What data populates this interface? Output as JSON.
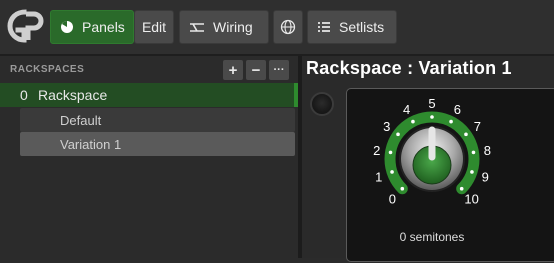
{
  "toolbar": {
    "logo": "gig-performer-logo",
    "buttons": [
      {
        "label": "Panels",
        "icon": "panels-icon",
        "active": true
      },
      {
        "label": "Edit",
        "icon": "",
        "active": false
      },
      {
        "label": "Wiring",
        "icon": "wiring-icon",
        "active": false
      },
      {
        "label": "",
        "icon": "globe-icon",
        "active": false
      },
      {
        "label": "Setlists",
        "icon": "list-icon",
        "active": false
      }
    ]
  },
  "rackspaces": {
    "header": "RACKSPACES",
    "add_label": "+",
    "remove_label": "−",
    "menu_label": "···",
    "items": [
      {
        "number": "0",
        "name": "Rackspace",
        "variations": [
          "Default",
          "Variation 1"
        ],
        "selected_variation": "Variation 1"
      }
    ]
  },
  "panel": {
    "title": "Rackspace : Variation 1",
    "knob": {
      "scale_labels": [
        "0",
        "1",
        "2",
        "3",
        "4",
        "5",
        "6",
        "7",
        "8",
        "9",
        "10"
      ],
      "value": 5,
      "caption": "0 semitones",
      "accent_color": "#2e8b2e"
    }
  },
  "colors": {
    "active_green": "#2a6a2a",
    "selected_row": "#234d23"
  }
}
